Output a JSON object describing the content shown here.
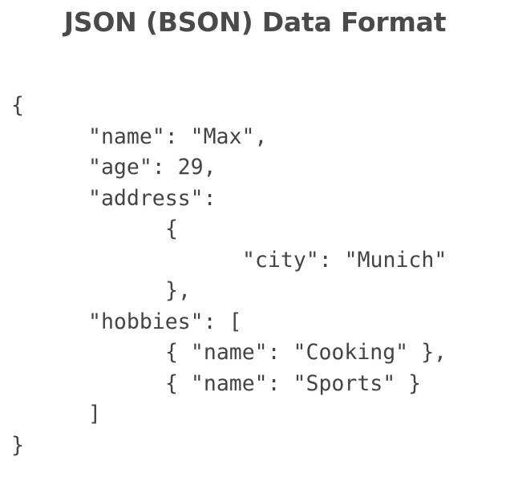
{
  "title": "JSON (BSON) Data Format",
  "code_lines": [
    {
      "indent": 0,
      "text": "{"
    },
    {
      "indent": 1,
      "text": "\"name\": \"Max\","
    },
    {
      "indent": 1,
      "text": "\"age\": 29,"
    },
    {
      "indent": 1,
      "text": "\"address\":"
    },
    {
      "indent": 2,
      "text": "{"
    },
    {
      "indent": 3,
      "text": "\"city\": \"Munich\""
    },
    {
      "indent": 2,
      "text": "},"
    },
    {
      "indent": 1,
      "text": "\"hobbies\": ["
    },
    {
      "indent": 2,
      "text": "{ \"name\": \"Cooking\" },"
    },
    {
      "indent": 2,
      "text": "{ \"name\": \"Sports\" }"
    },
    {
      "indent": 1,
      "text": "]"
    },
    {
      "indent": 0,
      "text": "}"
    }
  ]
}
